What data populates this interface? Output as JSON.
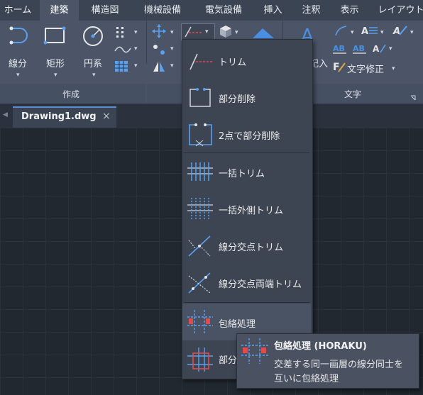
{
  "menu": {
    "tabs": [
      {
        "label": "ホーム"
      },
      {
        "label": "建築"
      },
      {
        "label": "構造図"
      },
      {
        "label": "機械設備"
      },
      {
        "label": "電気設備"
      },
      {
        "label": "挿入"
      },
      {
        "label": "注釈"
      },
      {
        "label": "表示"
      },
      {
        "label": "レイアウト"
      }
    ],
    "active": "建築"
  },
  "ribbon": {
    "create_panel": {
      "title": "作成",
      "line_label": "線分",
      "rect_label": "矩形",
      "circle_label": "円系"
    },
    "text_panel": {
      "title": "文字",
      "write_label": "記入",
      "edit_text_label": "文字修正"
    }
  },
  "document_tab": {
    "name": "Drawing1.dwg",
    "close": "×"
  },
  "dropdown": {
    "items": [
      {
        "label": "トリム",
        "icon": "trim-icon"
      },
      {
        "label": "部分削除",
        "icon": "partial-delete-icon"
      },
      {
        "label": "2点で部分削除",
        "icon": "two-point-delete-icon"
      },
      {
        "label": "一括トリム",
        "icon": "batch-trim-icon"
      },
      {
        "label": "一括外側トリム",
        "icon": "batch-outer-trim-icon"
      },
      {
        "label": "線分交点トリム",
        "icon": "intersection-trim-icon"
      },
      {
        "label": "線分交点両端トリム",
        "icon": "intersection-both-trim-icon"
      },
      {
        "label": "包絡処理",
        "icon": "envelope-icon"
      },
      {
        "label": "部分",
        "icon": "partial-envelope-icon"
      }
    ]
  },
  "tooltip": {
    "title": "包絡処理 (HORAKU)",
    "line1": "交差する同一画層の線分同士を",
    "line2": "互いに包絡処理"
  },
  "colors": {
    "accent_blue": "#4a90e2",
    "accent_red": "#e04b4b",
    "ribbon_bg": "#4b5567",
    "canvas_bg": "#212830"
  }
}
